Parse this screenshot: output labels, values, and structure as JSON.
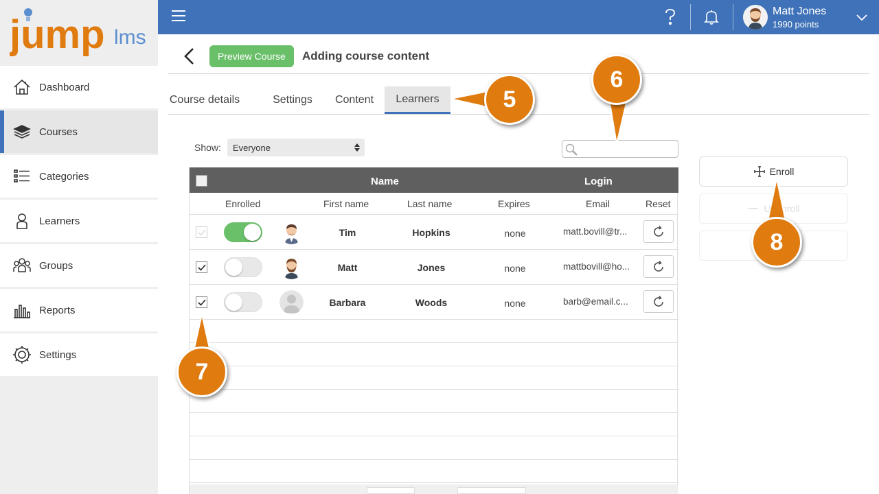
{
  "app": {
    "logo_text_jump": "jump",
    "logo_text_lms": "lms"
  },
  "sidebar": {
    "items": [
      {
        "label": "Dashboard",
        "icon": "house-icon",
        "active": false
      },
      {
        "label": "Courses",
        "icon": "books-icon",
        "active": true
      },
      {
        "label": "Categories",
        "icon": "list-icon",
        "active": false
      },
      {
        "label": "Learners",
        "icon": "person-icon",
        "active": false
      },
      {
        "label": "Groups",
        "icon": "group-icon",
        "active": false
      },
      {
        "label": "Reports",
        "icon": "bar-chart-icon",
        "active": false
      },
      {
        "label": "Settings",
        "icon": "gear-icon",
        "active": false
      }
    ]
  },
  "topbar": {
    "user_name": "Matt Jones",
    "user_points": "1990 points",
    "help_icon": "question-icon",
    "notification_icon": "bell-icon"
  },
  "header": {
    "preview_label": "Preview Course",
    "title": "Adding course content"
  },
  "tabs": [
    {
      "label": "Course details",
      "active": false
    },
    {
      "label": "Settings",
      "active": false
    },
    {
      "label": "Content",
      "active": false
    },
    {
      "label": "Learners",
      "active": true
    }
  ],
  "filter": {
    "show_label": "Show:",
    "show_value": "Everyone",
    "search_placeholder": "",
    "search_value": ""
  },
  "table": {
    "group_headers": {
      "name": "Name",
      "login": "Login"
    },
    "columns": {
      "enrolled": "Enrolled",
      "first_name": "First name",
      "last_name": "Last name",
      "expires": "Expires",
      "email": "Email",
      "reset": "Reset"
    },
    "rows": [
      {
        "checked": false,
        "disabled": true,
        "enrolled": true,
        "first_name": "Tim",
        "last_name": "Hopkins",
        "expires": "none",
        "email": "matt.bovill@tr..."
      },
      {
        "checked": true,
        "disabled": false,
        "enrolled": false,
        "first_name": "Matt",
        "last_name": "Jones",
        "expires": "none",
        "email": "mattbovill@ho..."
      },
      {
        "checked": true,
        "disabled": false,
        "enrolled": false,
        "first_name": "Barbara",
        "last_name": "Woods",
        "expires": "none",
        "email": "barb@email.c..."
      }
    ]
  },
  "actions": {
    "enroll_label": "Enroll",
    "unenroll_label": "Unenroll",
    "third_label": ""
  },
  "callouts": [
    "5",
    "6",
    "7",
    "8"
  ],
  "colors": {
    "primary": "#3f72b8",
    "success": "#6abf69",
    "callout": "#e07b10",
    "header_dark": "#5f5f5f"
  }
}
